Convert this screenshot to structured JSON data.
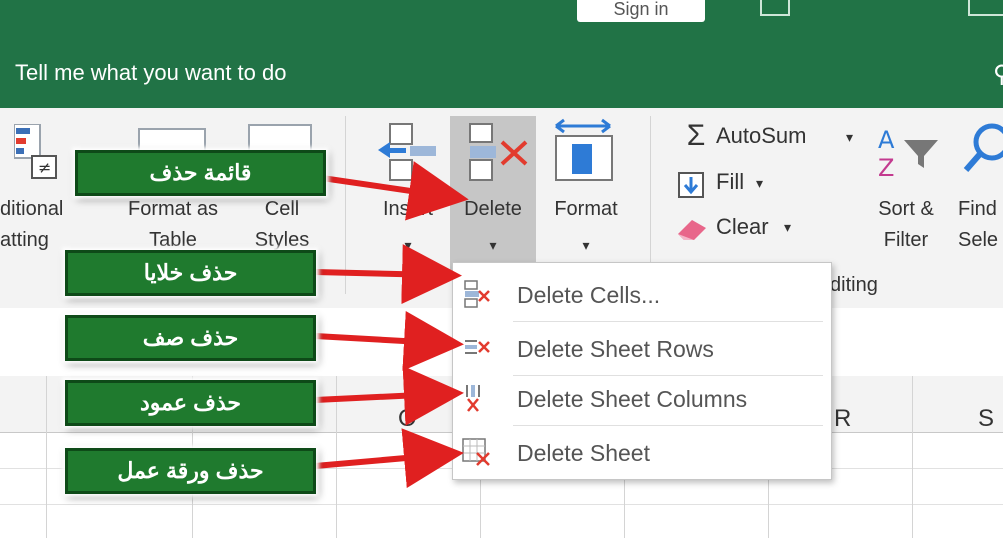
{
  "title_bar": {
    "signin_label": "Sign in",
    "tell_me": "Tell me what you want to do"
  },
  "ribbon": {
    "conditional_formatting_label": "ditional\natting",
    "format_as_table_label": "Format as\nTable",
    "cell_styles_label": "Cell\nStyles",
    "insert_label": "Insert",
    "delete_label": "Delete",
    "format_label": "Format",
    "autosum_label": "AutoSum",
    "fill_label": "Fill",
    "clear_label": "Clear",
    "sort_filter_label": "Sort &\nFilter",
    "find_select_label": "Find\nSele",
    "editing_group_label": "diting"
  },
  "columns": [
    "O",
    "R",
    "S"
  ],
  "delete_menu": {
    "items": [
      {
        "label": "Delete Cells...",
        "icon": "delete-cells-icon"
      },
      {
        "label": "Delete Sheet Rows",
        "icon": "delete-rows-icon"
      },
      {
        "label": "Delete Sheet Columns",
        "icon": "delete-columns-icon"
      },
      {
        "label": "Delete Sheet",
        "icon": "delete-sheet-icon"
      }
    ]
  },
  "callouts": [
    "قائمة حذف",
    "حذف خلايا",
    "حذف صف",
    "حذف عمود",
    "حذف ورقة عمل"
  ],
  "colors": {
    "accent_green": "#217346",
    "callout_green": "#1f7a2e",
    "arrow_red": "#e02020"
  }
}
